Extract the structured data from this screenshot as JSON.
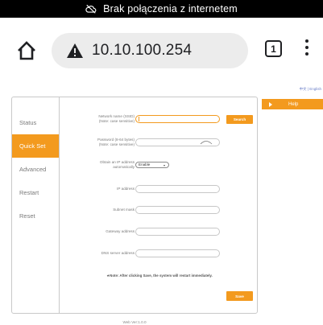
{
  "status_bar": {
    "offline_text": "Brak połączenia z internetem"
  },
  "browser": {
    "url": "10.10.100.254",
    "tab_count": "1"
  },
  "page": {
    "language_switch": "中文 | English",
    "nav": [
      "Status",
      "Quick Set",
      "Advanced",
      "Restart",
      "Reset"
    ],
    "active_nav": "Quick Set",
    "form": {
      "ssid_label": "Network name (SSID)",
      "ssid_note": "(Note: case sensitive)",
      "search_button": "Search",
      "password_label": "Password (8-64 bytes)",
      "password_note": "(Note: case sensitive)",
      "auto_ip_label": "Obtain an IP address",
      "auto_ip_label2": "automatically",
      "auto_ip_value": "Enable",
      "ip_label": "IP address",
      "subnet_label": "Subnet mask",
      "gateway_label": "Gateway address",
      "dns_label": "DNS server address",
      "note": "★Note: After clicking Save, the system will restart immediately.",
      "save_button": "Save"
    },
    "help_label": "Help",
    "web_version": "Web Ver:1.0.0"
  },
  "colors": {
    "accent": "#f39a1e",
    "status_bar": "#000000",
    "url_pill": "#ececec"
  }
}
